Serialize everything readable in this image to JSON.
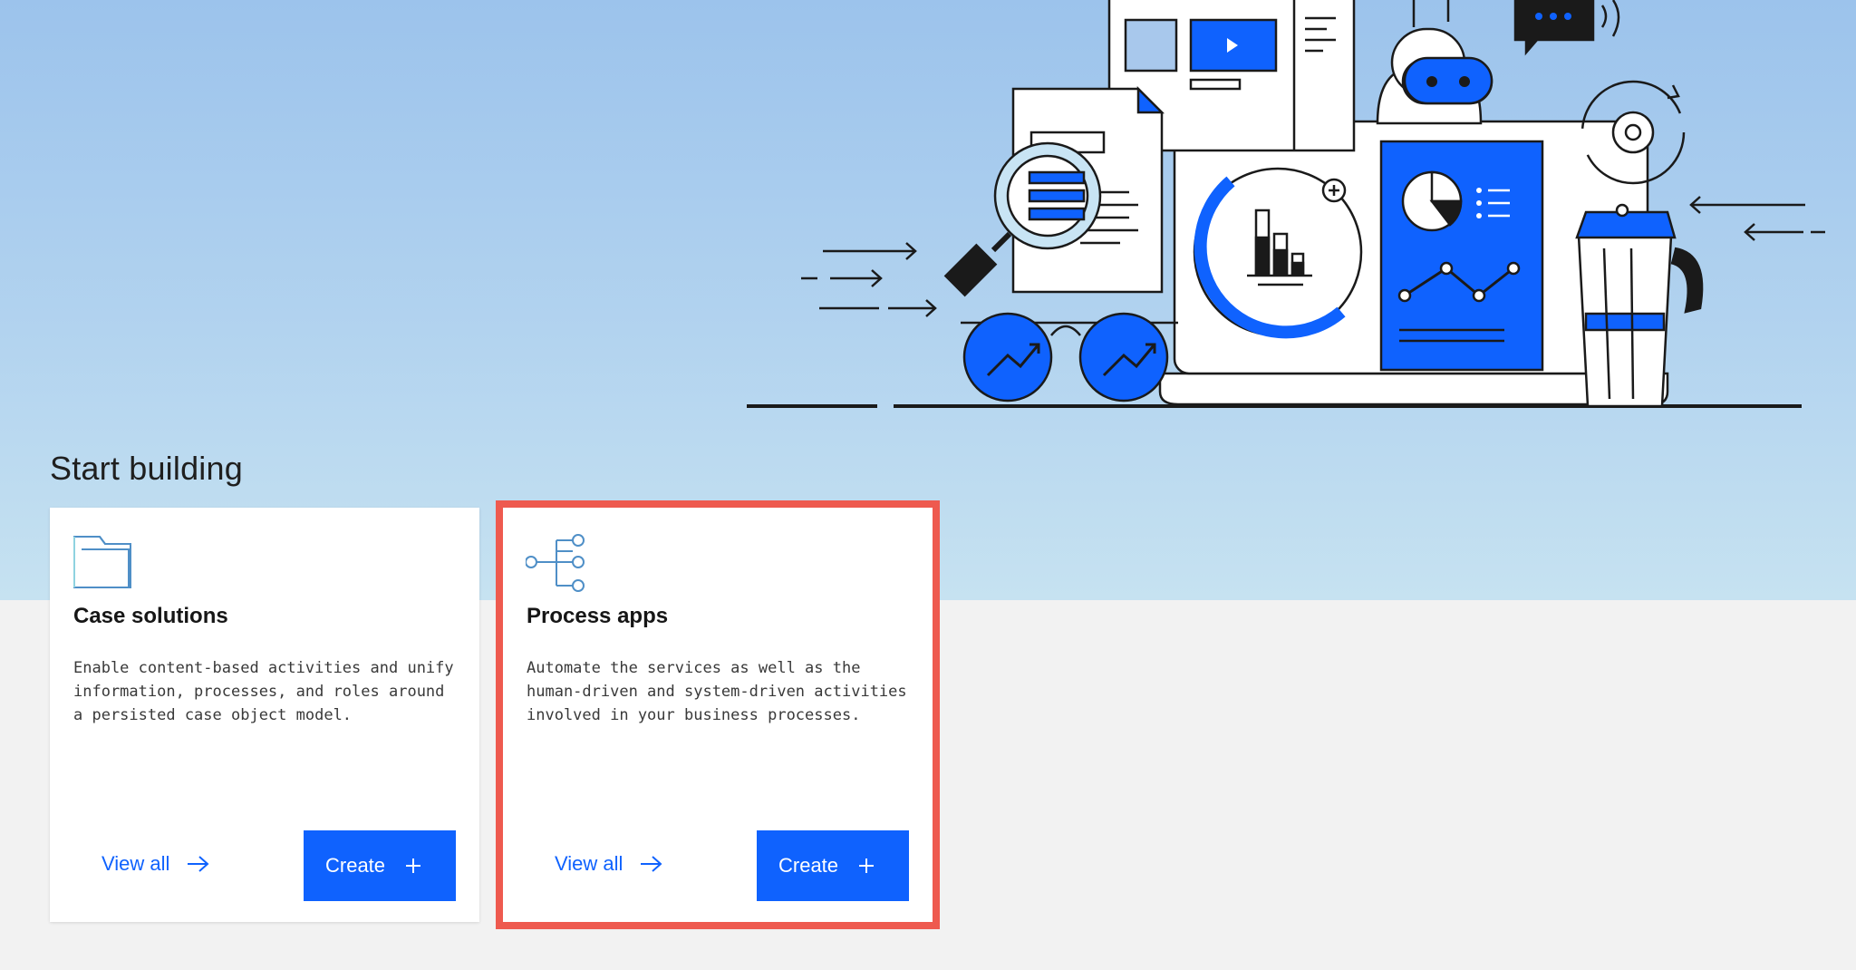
{
  "section": {
    "title": "Start building"
  },
  "cards": [
    {
      "icon": "folder-icon",
      "title": "Case solutions",
      "description": "Enable content-based activities and unify information, processes, and roles around a persisted case object model.",
      "view_all_label": "View all",
      "create_label": "Create"
    },
    {
      "icon": "process-tree-icon",
      "title": "Process apps",
      "description": "Automate the services as well as the human-driven and system-driven activities involved in your business processes.",
      "view_all_label": "View all",
      "create_label": "Create",
      "highlighted": true
    }
  ],
  "colors": {
    "primary": "#0f62fe",
    "highlight_outline": "#ee5a4f",
    "hero_top": "#9cc3ec",
    "hero_bottom": "#c6e2f1",
    "page_bg": "#f2f2f2"
  }
}
